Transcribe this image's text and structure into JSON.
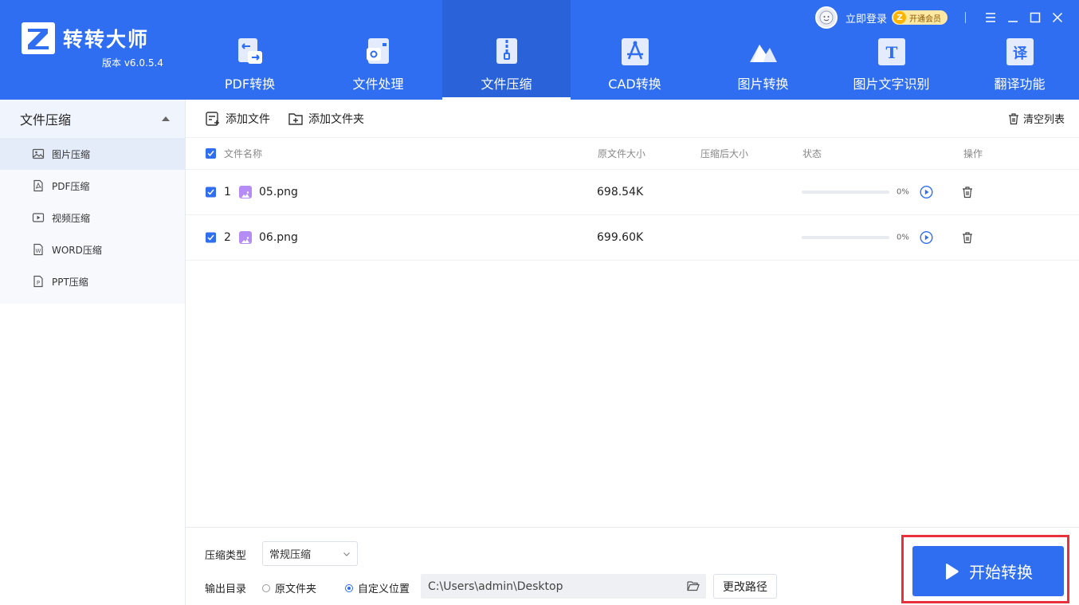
{
  "app": {
    "brand": "转转大师",
    "version": "版本 v6.0.5.4",
    "login_label": "立即登录",
    "vip_label": "开通会员",
    "vip_badge": "Z"
  },
  "nav": [
    {
      "label": "PDF转换",
      "icon": "pdf-convert-icon"
    },
    {
      "label": "文件处理",
      "icon": "file-process-icon"
    },
    {
      "label": "文件压缩",
      "icon": "file-compress-icon",
      "active": true
    },
    {
      "label": "CAD转换",
      "icon": "cad-convert-icon"
    },
    {
      "label": "图片转换",
      "icon": "image-convert-icon"
    },
    {
      "label": "图片文字识别",
      "icon": "ocr-icon",
      "glyph": "T"
    },
    {
      "label": "翻译功能",
      "icon": "translate-icon",
      "glyph": "译"
    }
  ],
  "sidebar": {
    "title": "文件压缩",
    "items": [
      {
        "label": "图片压缩",
        "icon": "image-icon",
        "active": true
      },
      {
        "label": "PDF压缩",
        "icon": "pdf-icon"
      },
      {
        "label": "视频压缩",
        "icon": "video-icon"
      },
      {
        "label": "WORD压缩",
        "icon": "word-icon",
        "glyph": "W"
      },
      {
        "label": "PPT压缩",
        "icon": "ppt-icon",
        "glyph": "P"
      }
    ]
  },
  "toolbar": {
    "add_file": "添加文件",
    "add_folder": "添加文件夹",
    "clear_list": "清空列表"
  },
  "table": {
    "headers": {
      "name": "文件名称",
      "orig_size": "原文件大小",
      "comp_size": "压缩后大小",
      "status": "状态",
      "action": "操作"
    },
    "rows": [
      {
        "index": "1",
        "name": "05.png",
        "orig_size": "698.54K",
        "comp_size": "",
        "progress": 0,
        "progress_label": "0%",
        "checked": true
      },
      {
        "index": "2",
        "name": "06.png",
        "orig_size": "699.60K",
        "comp_size": "",
        "progress": 0,
        "progress_label": "0%",
        "checked": true
      }
    ]
  },
  "settings": {
    "compress_type_label": "压缩类型",
    "compress_type_value": "常规压缩",
    "output_dir_label": "输出目录",
    "option_original": "原文件夹",
    "option_custom": "自定义位置",
    "selected_option": "custom",
    "path": "C:\\Users\\admin\\Desktop",
    "change_path": "更改路径",
    "start_button": "开始转换"
  },
  "colors": {
    "accent": "#2f6ef0",
    "highlight_border": "#e8313a"
  }
}
